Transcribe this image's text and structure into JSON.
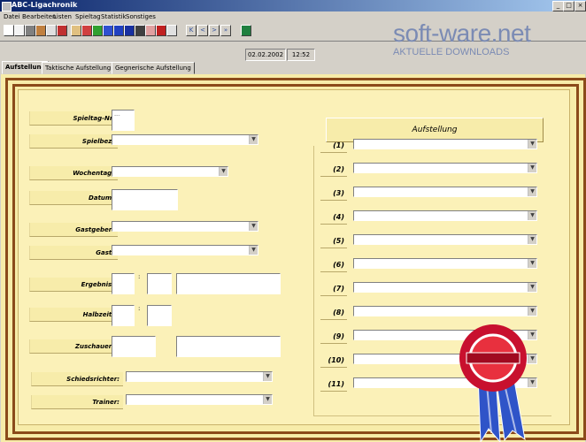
{
  "window": {
    "title": "ABC-Ligachronik",
    "minimize": "_",
    "maximize": "□",
    "close": "×"
  },
  "menu": [
    "Datei",
    "Bearbeiten",
    "Listen",
    "Spieltag",
    "Statistik",
    "Sonstiges"
  ],
  "toolbar": {
    "nav": [
      "K",
      "<",
      ">",
      "»"
    ]
  },
  "status": {
    "date": "02.02.2002",
    "time": "12:52"
  },
  "logo": {
    "brand": "soft-ware.net",
    "tagline": "AKTUELLE DOWNLOADS"
  },
  "tabs": [
    "Aufstellung",
    "Taktische Aufstellung",
    "Gegnerische Aufstellung"
  ],
  "form": {
    "spieltag_nr": "Spieltag-Nr.",
    "spielbez": "Spielbez.",
    "wochentag": "Wochentag:",
    "datum": "Datum:",
    "gastgeber": "Gastgeber:",
    "gast": "Gast:",
    "ergebnis": "Ergebnis:",
    "halbzeit": "Halbzeit:",
    "zuschauer": "Zuschauer:",
    "schiedsrichter": "Schiedsrichter:",
    "trainer": "Trainer:",
    "colon": ":",
    "spieltag_value": "---"
  },
  "aufstellung": {
    "title": "Aufstellung",
    "slots": [
      "(1)",
      "(2)",
      "(3)",
      "(4)",
      "(5)",
      "(6)",
      "(7)",
      "(8)",
      "(9)",
      "(10)",
      "(11)"
    ]
  },
  "colors": {
    "panel": "#f7eca9",
    "frame": "#8b4a1a",
    "title_bar": "#0a246a"
  }
}
